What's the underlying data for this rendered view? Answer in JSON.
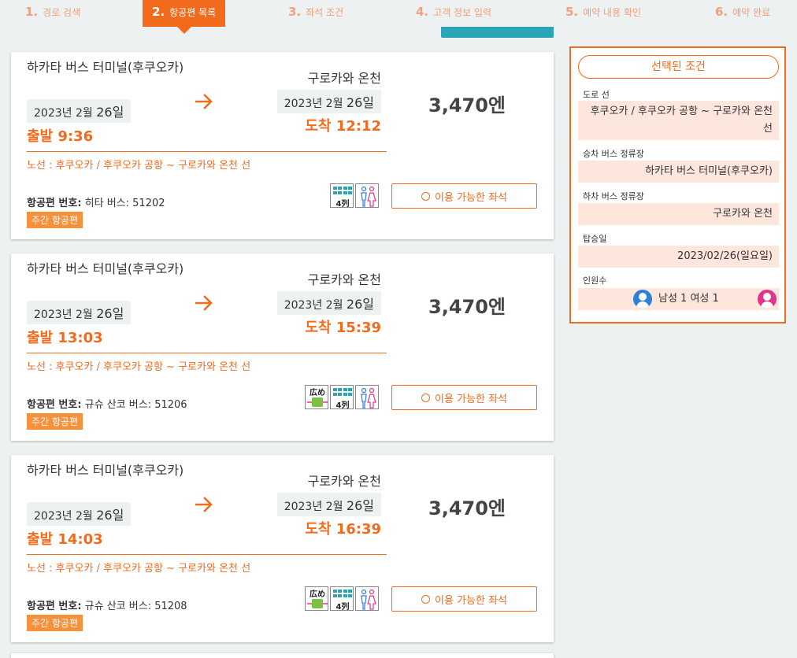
{
  "steps": [
    {
      "num": "1.",
      "label": "경로 검색"
    },
    {
      "num": "2.",
      "label": "항공편 목록"
    },
    {
      "num": "3.",
      "label": "좌석 조건"
    },
    {
      "num": "4.",
      "label": "고객 정보 입력"
    },
    {
      "num": "5.",
      "label": "예약 내용 확인"
    },
    {
      "num": "6.",
      "label": "예약 완료"
    }
  ],
  "results": [
    {
      "from": "하카타 버스 터미널(후쿠오카)",
      "from_date_pre": "2023년 2월 ",
      "from_date_day": "26일",
      "depart": "출발 9:36",
      "to": "구로카와 온천",
      "to_date_pre": "2023년 2월 ",
      "to_date_day": "26일",
      "arrive": "도착 12:12",
      "price": "3,470엔",
      "route": "노선 : 후쿠오카 / 후쿠오카 공항 ~ 구로카와 온천 선",
      "flight_label": "항공편 번호:",
      "flight_value": " 히타 버스: 51202",
      "badge": "주간 항공편",
      "seat_button": "이용 가능한 좌석"
    },
    {
      "from": "하카타 버스 터미널(후쿠오카)",
      "from_date_pre": "2023년 2월 ",
      "from_date_day": "26일",
      "depart": "출발 13:03",
      "to": "구로카와 온천",
      "to_date_pre": "2023년 2월 ",
      "to_date_day": "26일",
      "arrive": "도착 15:39",
      "price": "3,470엔",
      "route": "노선 : 후쿠오카 / 후쿠오카 공항 ~ 구로카와 온천 선",
      "flight_label": "항공편 번호:",
      "flight_value": " 규슈 산코 버스: 51206",
      "badge": "주간 항공편",
      "seat_button": "이용 가능한 좌석"
    },
    {
      "from": "하카타 버스 터미널(후쿠오카)",
      "from_date_pre": "2023년 2월 ",
      "from_date_day": "26일",
      "depart": "출발 14:03",
      "to": "구로카와 온천",
      "to_date_pre": "2023년 2월 ",
      "to_date_day": "26일",
      "arrive": "도착 16:39",
      "price": "3,470엔",
      "route": "노선 : 후쿠오카 / 후쿠오카 공항 ~ 구로카와 온천 선",
      "flight_label": "항공편 번호:",
      "flight_value": " 규슈 산코 버스: 51208",
      "badge": "주간 항공편",
      "seat_button": "이용 가능한 좌석"
    }
  ],
  "icon_text": {
    "rows": "4列",
    "wide": "広め"
  },
  "sidebar": {
    "title": "선택된 조건",
    "route_label": "도로 선",
    "route_value": "후쿠오카 / 후쿠오카 공항 ~ 구로카와 온천선",
    "board_label": "승차 버스 정류장",
    "board_value": "하카타 버스 터미널(후쿠오카)",
    "alight_label": "하차 버스 정류장",
    "alight_value": "구로카와 온천",
    "date_label": "탑승일",
    "date_value": "2023/02/26(일요일)",
    "pax_label": "인원수",
    "pax_value": "남성 1 여성 1"
  },
  "colors": {
    "accent": "#f26b1d",
    "teal": "#2aa5b5",
    "male": "#2f80d8",
    "female": "#e0358a"
  }
}
